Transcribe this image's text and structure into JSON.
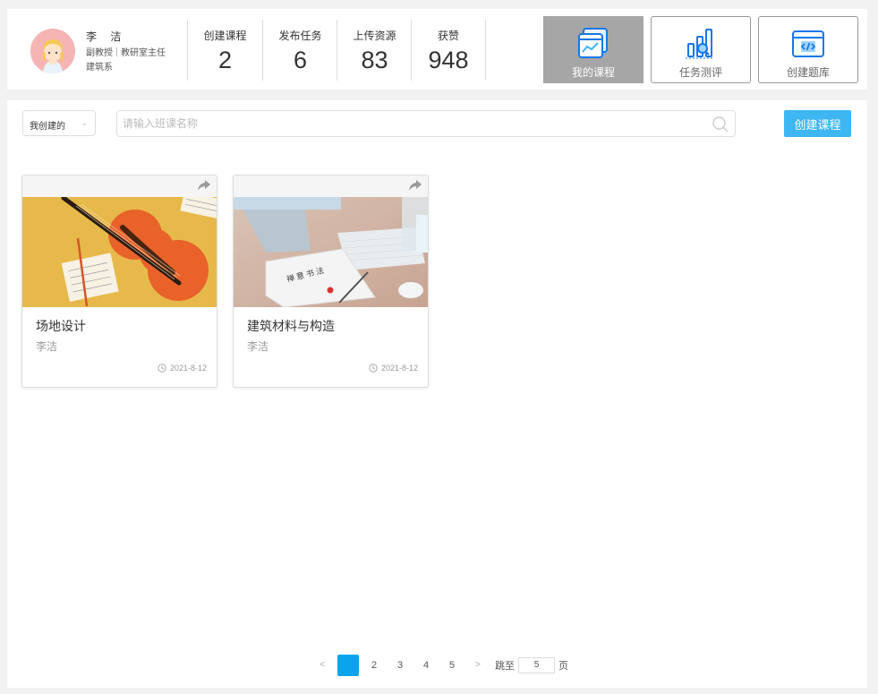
{
  "user": {
    "name": "李 洁",
    "title": "副教授",
    "role": "教研室主任",
    "department": "建筑系"
  },
  "stats": [
    {
      "label": "创建课程",
      "value": "2"
    },
    {
      "label": "发布任务",
      "value": "6"
    },
    {
      "label": "上传资源",
      "value": "83"
    },
    {
      "label": "获赞",
      "value": "948"
    }
  ],
  "nav": [
    {
      "label": "我的课程",
      "icon": "course-window-icon",
      "active": true
    },
    {
      "label": "任务测评",
      "icon": "bar-chart-magnifier-icon",
      "active": false
    },
    {
      "label": "创建题库",
      "icon": "code-window-icon",
      "active": false
    }
  ],
  "toolbar": {
    "filter_value": "我创建的",
    "search_placeholder": "请输入班课名称",
    "create_label": "创建课程"
  },
  "courses": [
    {
      "title": "场地设计",
      "author": "李洁",
      "date": "2021-8-12",
      "image": "violin-on-yellow"
    },
    {
      "title": "建筑材料与构造",
      "author": "李洁",
      "date": "2021-8-12",
      "image": "desk-keyboard-tablet"
    }
  ],
  "pagination": {
    "prev": "<",
    "pages": [
      "1",
      "2",
      "3",
      "4",
      "5"
    ],
    "current_index": 0,
    "current_label": "",
    "next": ">",
    "jump_label": "跳至",
    "jump_value": "5",
    "page_unit": "页"
  },
  "colors": {
    "accent": "#3db6f2",
    "pager_active": "#0aa4ec",
    "nav_active_bg": "#a6a6a6"
  }
}
